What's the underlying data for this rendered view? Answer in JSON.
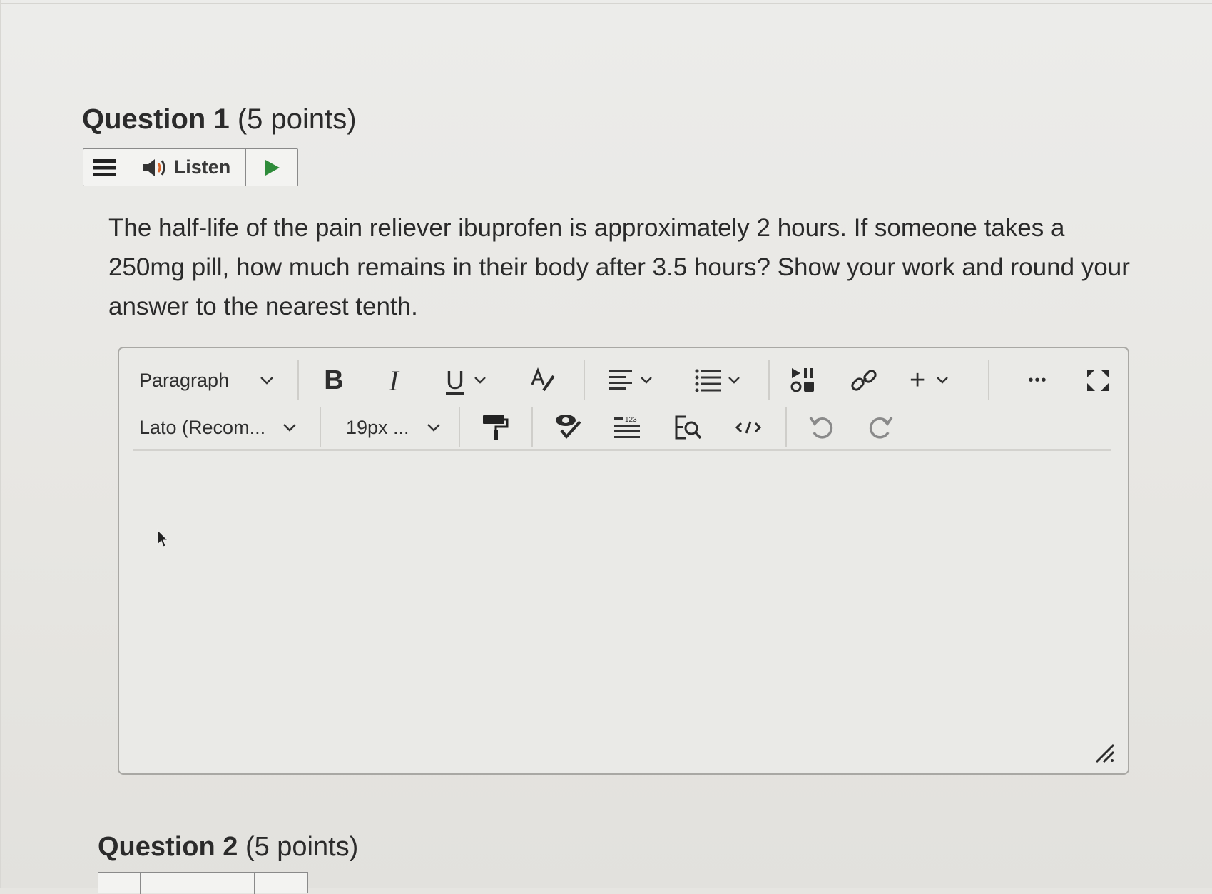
{
  "question1": {
    "number_label": "Question 1",
    "points_label": "(5 points)",
    "listen_label": "Listen",
    "text": "The half-life of the pain reliever ibuprofen is approximately 2 hours. If someone takes a 250mg pill, how much remains in their body after 3.5 hours? Show your work and round your answer to the nearest tenth."
  },
  "editor": {
    "block_format": "Paragraph",
    "font_family": "Lato (Recom...",
    "font_size": "19px ...",
    "bold_label": "B",
    "italic_label": "I",
    "underline_label": "U",
    "insert_label": "+",
    "more_label": "•••",
    "content": ""
  },
  "question2": {
    "number_label": "Question 2",
    "points_label": "(5 points)"
  }
}
